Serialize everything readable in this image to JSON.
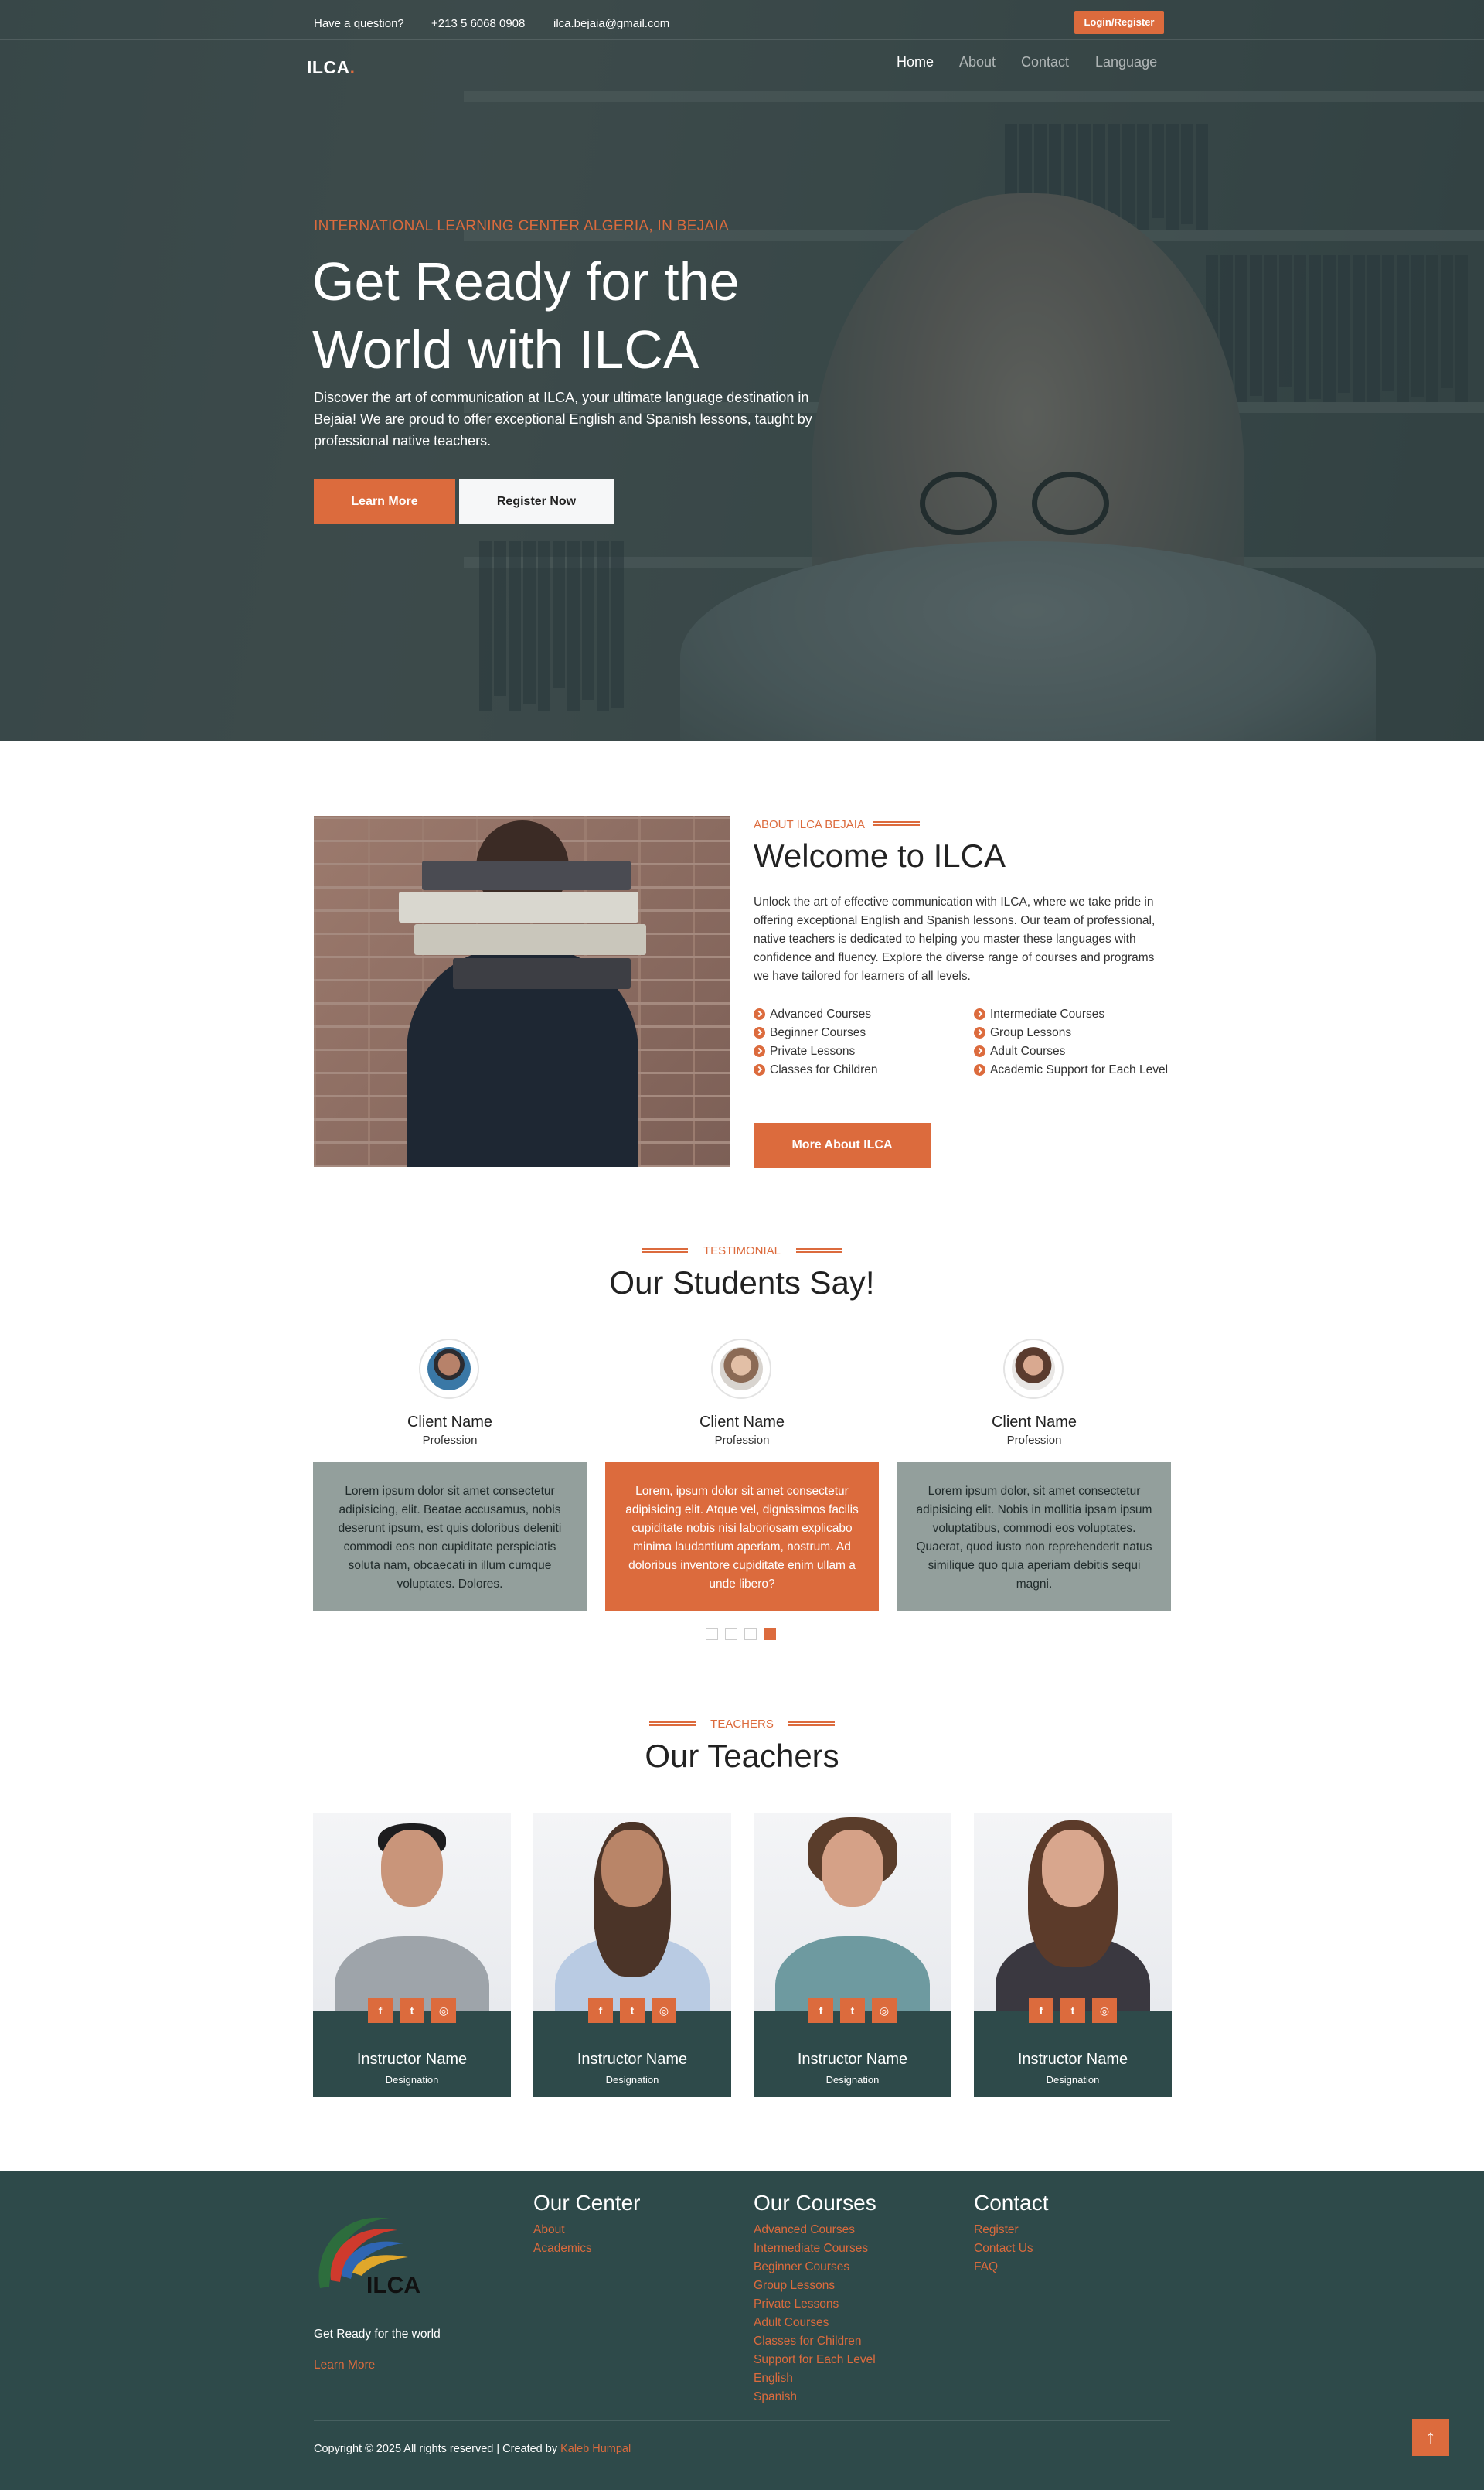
{
  "topbar": {
    "question": "Have a question?",
    "phone": "+213 5 6068 0908",
    "email": "ilca.bejaia@gmail.com",
    "login_label": "Login/Register"
  },
  "brand": {
    "name": "ILCA",
    "dot": "."
  },
  "nav": [
    {
      "label": "Home",
      "active": true
    },
    {
      "label": "About",
      "active": false
    },
    {
      "label": "Contact",
      "active": false
    },
    {
      "label": "Language",
      "active": false
    }
  ],
  "hero": {
    "kicker": "INTERNATIONAL LEARNING CENTER ALGERIA, IN BEJAIA",
    "title_line1": "Get Ready for the",
    "title_line2": "World with ILCA",
    "text": "Discover the art of communication at ILCA, your ultimate language destination in Bejaia! We are proud to offer exceptional English and Spanish lessons, taught by professional native teachers.",
    "learn_more": "Learn More",
    "register_now": "Register Now"
  },
  "about": {
    "kicker": "ABOUT ILCA BEJAIA",
    "title": "Welcome to ILCA",
    "text": "Unlock the art of effective communication with ILCA, where we take pride in offering exceptional English and Spanish lessons. Our team of professional, native teachers is dedicated to helping you master these languages with confidence and fluency. Explore the diverse range of courses and programs we have tailored for learners of all levels.",
    "bullets_left": [
      "Advanced Courses",
      "Beginner Courses",
      "Private Lessons",
      "Classes for Children"
    ],
    "bullets_right": [
      "Intermediate Courses",
      "Group Lessons",
      "Adult Courses",
      "Academic Support for Each Level"
    ],
    "button": "More About ILCA"
  },
  "testimonial": {
    "kicker": "TESTIMONIAL",
    "title": "Our Students Say!",
    "items": [
      {
        "name": "Client Name",
        "profession": "Profession",
        "text": "Lorem ipsum dolor sit amet consectetur adipisicing, elit. Beatae accusamus, nobis deserunt ipsum, est quis doloribus deleniti commodi eos non cupiditate perspiciatis soluta nam, obcaecati in illum cumque voluptates. Dolores."
      },
      {
        "name": "Client Name",
        "profession": "Profession",
        "text": "Lorem, ipsum dolor sit amet consectetur adipisicing elit. Atque vel, dignissimos facilis cupiditate nobis nisi laboriosam explicabo minima laudantium aperiam, nostrum. Ad doloribus inventore cupiditate enim ullam a unde libero?"
      },
      {
        "name": "Client Name",
        "profession": "Profession",
        "text": "Lorem ipsum dolor, sit amet consectetur adipisicing elit. Nobis in mollitia ipsam ipsum voluptatibus, commodi eos voluptates. Quaerat, quod iusto non reprehenderit natus similique quo quia aperiam debitis sequi magni."
      }
    ]
  },
  "teachers": {
    "kicker": "TEACHERS",
    "title": "Our Teachers",
    "items": [
      {
        "name": "Instructor Name",
        "designation": "Designation"
      },
      {
        "name": "Instructor Name",
        "designation": "Designation"
      },
      {
        "name": "Instructor Name",
        "designation": "Designation"
      },
      {
        "name": "Instructor Name",
        "designation": "Designation"
      }
    ],
    "social_icons": {
      "facebook": "f",
      "twitter": "t",
      "instagram": "◎"
    }
  },
  "footer": {
    "logo_text": "ILCA",
    "tagline": "Get Ready for the world",
    "learn_more": "Learn More",
    "center_title": "Our Center",
    "center_links": [
      "About",
      "Academics"
    ],
    "courses_title": "Our Courses",
    "courses_links": [
      "Advanced Courses",
      "Intermediate Courses",
      "Beginner Courses",
      "Group Lessons",
      "Private Lessons",
      "Adult Courses",
      "Classes for Children",
      "Support for Each Level",
      "English",
      "Spanish"
    ],
    "contact_title": "Contact",
    "contact_links": [
      "Register",
      "Contact Us",
      "FAQ"
    ],
    "copyright": "Copyright © 2025 All rights reserved | Created by",
    "author": "Kaleb Humpal",
    "to_top": "↑"
  },
  "colors": {
    "accent": "#dc6b3d",
    "dark_teal": "#2e4a4a",
    "card_grey": "#939f9c"
  }
}
